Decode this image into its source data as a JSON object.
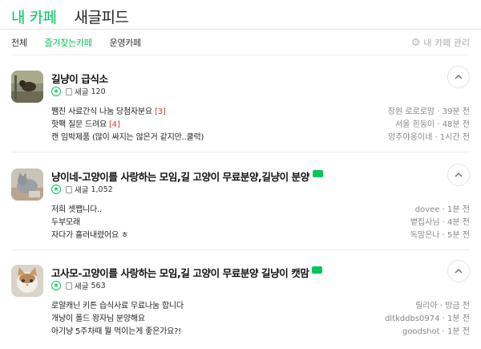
{
  "tabs": {
    "my_cafe": "내 카페",
    "new_feed": "새글피드"
  },
  "sub_tabs": [
    {
      "label": "전체"
    },
    {
      "label": "즐겨찾는카페"
    },
    {
      "label": "운영카페"
    }
  ],
  "manage_label": "내 카페 관리",
  "posts_count_label": "새글",
  "cafes": [
    {
      "name": "길냥이 급식소",
      "new_posts": "120",
      "has_badge": false,
      "posts": [
        {
          "title": "쨈친 사료간식 나눔 당첨자분요",
          "comments": "[3]",
          "author": "장원 로로로맘",
          "time": "39분 전"
        },
        {
          "title": "핫팩 질문 드려요",
          "comments": "[4]",
          "author": "서울 흰둥이",
          "time": "48분 전"
        },
        {
          "title": "캔 임박제품 (많이 싸지는 않은거 같지만..쿨럭)",
          "comments": "",
          "author": "양주야옹이네",
          "time": "1시간 전"
        }
      ]
    },
    {
      "name": "냥이네-고양이를 사랑하는 모임,길 고양이 무료분양,길냥이 분양",
      "new_posts": "1,052",
      "has_badge": true,
      "posts": [
        {
          "title": "저희 셋쨉니다..",
          "comments": "",
          "author": "dovee",
          "time": "1분 전"
        },
        {
          "title": "두부모래",
          "comments": "",
          "author": "볕집사님",
          "time": "4분 전"
        },
        {
          "title": "자다가 흘러내렸어요 ㅎ",
          "comments": "",
          "author": "독맘은나",
          "time": "5분 전"
        }
      ]
    },
    {
      "name": "고사모-고양이를 사랑하는 모임,길 고양이 무료분양 길냥이 캣맘",
      "new_posts": "563",
      "has_badge": true,
      "posts": [
        {
          "title": "로얄캐닌 키튼 습식사료 무료나눔 합니다",
          "comments": "",
          "author": "릴리아",
          "time": "방금 전"
        },
        {
          "title": "개냥이 폴드 왕자님 분양해요",
          "comments": "",
          "author": "dltkddbs0974",
          "time": "1분 전"
        },
        {
          "title": "아기냥 5주차때 뭘 먹이는게 좋은가요?!",
          "comments": "",
          "author": "goodshot",
          "time": "1분 전"
        }
      ]
    }
  ],
  "colors": {
    "accent": "#03c75a",
    "comment": "#e0372e"
  },
  "icons": {
    "favorite": "star-icon",
    "posts": "document-icon",
    "collapse": "chevron-up-icon",
    "settings": "gear-icon"
  }
}
